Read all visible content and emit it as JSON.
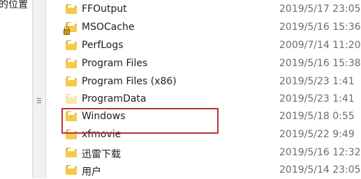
{
  "navigation_pane": {
    "partial_label": "的位置"
  },
  "file_list": {
    "rows": [
      {
        "name": "FFOutput",
        "modified": "2019/5/17 23:05",
        "icon": "folder-icon",
        "locked": false,
        "faded": false
      },
      {
        "name": "MSOCache",
        "modified": "2019/5/16 15:36",
        "icon": "folder-icon",
        "locked": true,
        "faded": false
      },
      {
        "name": "PerfLogs",
        "modified": "2009/7/14 11:20",
        "icon": "folder-icon",
        "locked": false,
        "faded": false
      },
      {
        "name": "Program Files",
        "modified": "2019/5/16 15:38",
        "icon": "folder-icon",
        "locked": false,
        "faded": false
      },
      {
        "name": "Program Files (x86)",
        "modified": "2019/5/23 1:41",
        "icon": "folder-icon",
        "locked": false,
        "faded": false
      },
      {
        "name": "ProgramData",
        "modified": "2019/5/23 1:41",
        "icon": "folder-icon",
        "locked": false,
        "faded": true
      },
      {
        "name": "Windows",
        "modified": "2019/5/18 0:55",
        "icon": "folder-icon",
        "locked": false,
        "faded": false,
        "highlighted": true
      },
      {
        "name": "xfmovie",
        "modified": "2019/5/22 9:49",
        "icon": "folder-icon",
        "locked": false,
        "faded": false
      },
      {
        "name": "迅雷下载",
        "modified": "2019/5/16 12:32",
        "icon": "folder-icon",
        "locked": false,
        "faded": false
      },
      {
        "name": "用户",
        "modified": "2019/5/14 23:05",
        "icon": "folder-icon",
        "locked": false,
        "faded": false
      }
    ]
  },
  "colors": {
    "highlight_border": "#b5323a",
    "date_text": "#6d6d6d",
    "name_text": "#1e1e1e",
    "folder": "#f5ca4b"
  }
}
